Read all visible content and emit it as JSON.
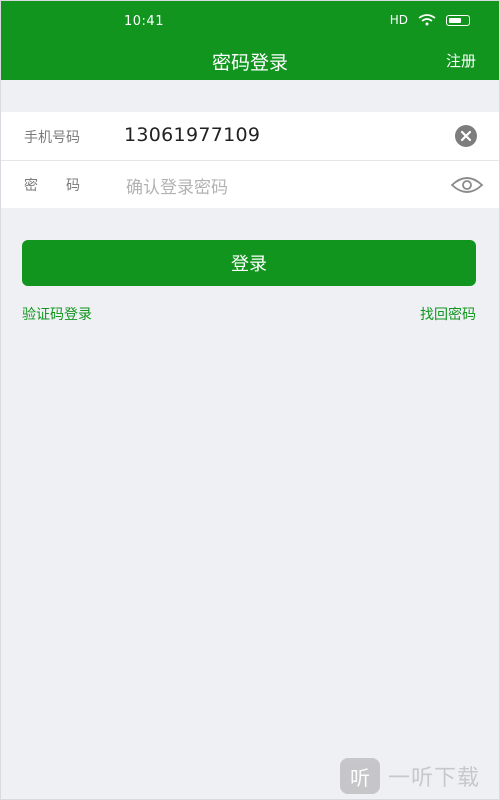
{
  "status_bar": {
    "time": "10:41",
    "network": "HD"
  },
  "nav": {
    "title": "密码登录",
    "register_label": "注册"
  },
  "form": {
    "phone_label": "手机号码",
    "phone_value": "13061977109",
    "password_label": "密　　码",
    "password_placeholder": "确认登录密码"
  },
  "actions": {
    "login_label": "登录",
    "sms_login_link": "验证码登录",
    "recover_password_link": "找回密码"
  },
  "watermark": {
    "badge": "听",
    "text": "一听下载"
  },
  "colors": {
    "primary": "#11951f",
    "background": "#eff0f4"
  },
  "icons": {
    "clear": "clear-icon",
    "toggle_visibility": "eye-icon"
  }
}
